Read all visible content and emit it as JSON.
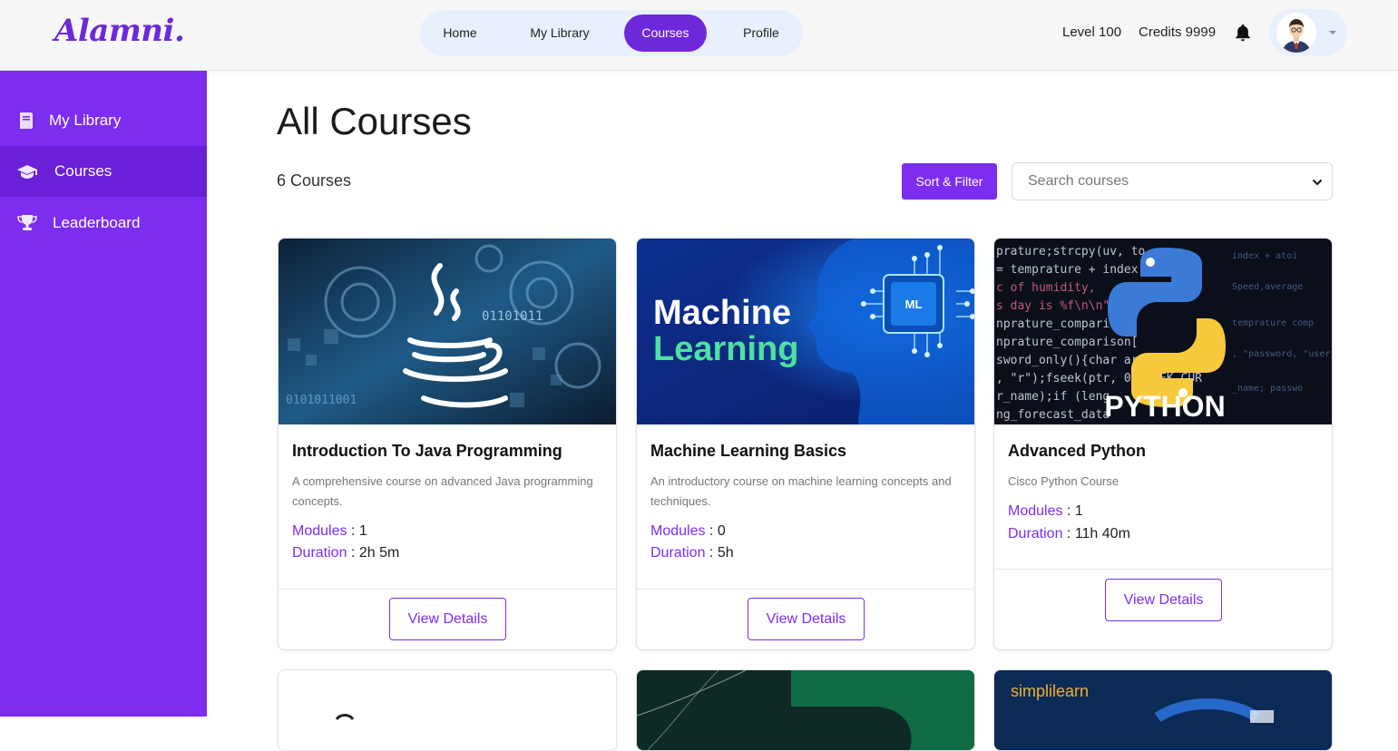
{
  "app": {
    "logo": "Alamni."
  },
  "nav": {
    "home": "Home",
    "my_library": "My Library",
    "courses": "Courses",
    "profile": "Profile"
  },
  "header": {
    "level": "Level 100",
    "credits": "Credits 9999"
  },
  "sidebar": {
    "items": [
      {
        "label": "My Library",
        "icon": "book-icon"
      },
      {
        "label": "Courses",
        "icon": "graduation-cap-icon"
      },
      {
        "label": "Leaderboard",
        "icon": "trophy-icon"
      }
    ]
  },
  "main": {
    "title": "All Courses",
    "count": "6 Courses",
    "sort_label": "Sort & Filter",
    "search_placeholder": "Search courses",
    "select_value": ""
  },
  "courses": [
    {
      "title": "Introduction To Java Programming",
      "description": "A comprehensive course on advanced Java programming concepts.",
      "modules_label": "Modules",
      "modules": " : 1",
      "duration_label": "Duration",
      "duration": " : 2h 5m",
      "button": "View Details"
    },
    {
      "title": "Machine Learning Basics",
      "description": "An introductory course on machine learning concepts and techniques.",
      "modules_label": "Modules",
      "modules": " : 0",
      "duration_label": "Duration",
      "duration": " : 5h",
      "button": "View Details",
      "thumb_text_1": "Machine",
      "thumb_text_2": "Learning",
      "thumb_badge": "ML"
    },
    {
      "title": "Advanced Python",
      "description": "Cisco Python Course",
      "modules_label": "Modules",
      "modules": " : 1",
      "duration_label": "Duration",
      "duration": " : 11h 40m",
      "button": "View Details",
      "thumb_text": "PYTHON"
    }
  ],
  "partial_cards": [
    {
      "brand": ""
    },
    {
      "brand": ""
    },
    {
      "brand": "simplilearn"
    }
  ],
  "colors": {
    "accent": "#7c2df0",
    "accent_dark": "#6a1fd9",
    "nav_bg": "#e7f0fc"
  }
}
